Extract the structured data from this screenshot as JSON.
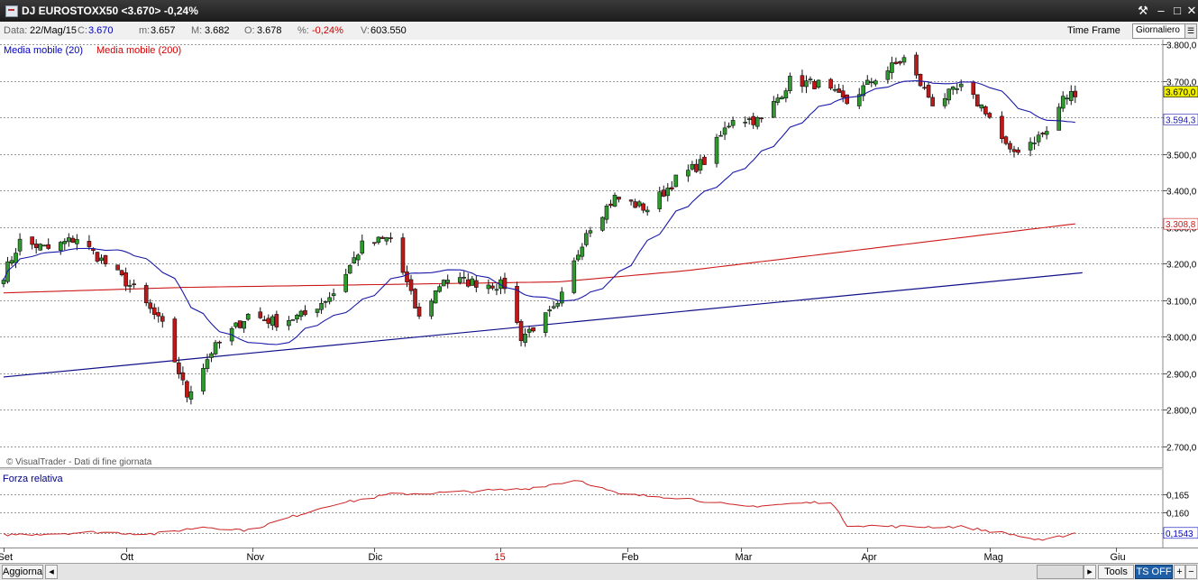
{
  "window": {
    "title": "DJ EUROSTOXX50 <3.670> -0,24%"
  },
  "infobar": {
    "data_label": "Data:",
    "data_value": "22/Mag/15",
    "c_label": "C:",
    "c_value": "3.670",
    "m_label": "m:",
    "m_value": "3.657",
    "M_label": "M:",
    "M_value": "3.682",
    "o_label": "O:",
    "o_value": "3.678",
    "pct_label": "%:",
    "pct_value": "-0,24%",
    "v_label": "V:",
    "v_value": "603.550",
    "time_frame_label": "Time Frame",
    "time_frame_value": "Giornaliero"
  },
  "legend": {
    "ma20": "Media mobile (20)",
    "ma200": "Media mobile (200)",
    "relative_strength": "Forza relativa",
    "credit": "© VisualTrader - Dati di fine giornata"
  },
  "bottombar": {
    "aggiorna": "Aggiorna",
    "tools": "Tools",
    "ts_off": "TS OFF",
    "plus": "+",
    "minus": "−"
  },
  "colors": {
    "up_candle": "#2e9a2e",
    "down_candle": "#c01818",
    "ma20": "#1a1aa8",
    "ma200": "#cc1a1a",
    "trendline": "#10108a",
    "rs_line": "#cc2020",
    "price_highlight": "#f0f000"
  },
  "chart_data": [
    {
      "type": "candlestick",
      "title": "DJ EUROSTOXX50",
      "x_axis_labels": [
        "Set",
        "Ott",
        "Nov",
        "Dic",
        "15",
        "Feb",
        "Mar",
        "Apr",
        "Mag",
        "Giu"
      ],
      "y_axis_labels": [
        "3.800,0",
        "3.700,0",
        "3.600,0",
        "3.500,0",
        "3.400,0",
        "3.300,0",
        "3.200,0",
        "3.100,0",
        "3.000,0",
        "2.900,0",
        "2.800,0",
        "2.700,0"
      ],
      "ylim": [
        2700,
        3800
      ],
      "grid": true,
      "last_price_label": "3.670,0",
      "ma20_last_label": "3.594,3",
      "ma200_last_label": "3.308,8",
      "anchors": [
        [
          "2014-09-01",
          3170
        ],
        [
          "2014-09-05",
          3260
        ],
        [
          "2014-09-12",
          3240
        ],
        [
          "2014-09-19",
          3270
        ],
        [
          "2014-09-26",
          3200
        ],
        [
          "2014-10-03",
          3130
        ],
        [
          "2014-10-10",
          3030
        ],
        [
          "2014-10-16",
          2840
        ],
        [
          "2014-10-22",
          2960
        ],
        [
          "2014-10-31",
          3060
        ],
        [
          "2014-11-07",
          3040
        ],
        [
          "2014-11-14",
          3060
        ],
        [
          "2014-11-21",
          3120
        ],
        [
          "2014-11-28",
          3250
        ],
        [
          "2014-12-05",
          3270
        ],
        [
          "2014-12-12",
          3050
        ],
        [
          "2014-12-18",
          3160
        ],
        [
          "2014-12-24",
          3150
        ],
        [
          "2015-01-02",
          3140
        ],
        [
          "2015-01-06",
          3000
        ],
        [
          "2015-01-15",
          3080
        ],
        [
          "2015-01-22",
          3290
        ],
        [
          "2015-01-29",
          3380
        ],
        [
          "2015-02-06",
          3350
        ],
        [
          "2015-02-13",
          3430
        ],
        [
          "2015-02-20",
          3480
        ],
        [
          "2015-02-27",
          3600
        ],
        [
          "2015-03-06",
          3590
        ],
        [
          "2015-03-13",
          3700
        ],
        [
          "2015-03-20",
          3690
        ],
        [
          "2015-03-27",
          3640
        ],
        [
          "2015-04-02",
          3700
        ],
        [
          "2015-04-10",
          3760
        ],
        [
          "2015-04-17",
          3640
        ],
        [
          "2015-04-24",
          3680
        ],
        [
          "2015-04-30",
          3620
        ],
        [
          "2015-05-06",
          3500
        ],
        [
          "2015-05-12",
          3540
        ],
        [
          "2015-05-15",
          3560
        ],
        [
          "2015-05-19",
          3650
        ],
        [
          "2015-05-22",
          3670
        ]
      ],
      "ma200": [
        [
          "2014-09-01",
          3120
        ],
        [
          "2014-10-15",
          3135
        ],
        [
          "2015-01-15",
          3150
        ],
        [
          "2015-02-15",
          3180
        ],
        [
          "2015-05-22",
          3308.8
        ]
      ],
      "trendline": [
        [
          "2014-09-01",
          2890
        ],
        [
          "2015-05-22",
          3175
        ]
      ]
    },
    {
      "type": "line",
      "title": "Forza relativa",
      "y_axis_labels": [
        "0,165",
        "0,160",
        "0,1543"
      ],
      "ylim": [
        0.1505,
        0.172
      ],
      "last_value_label": "0,1543",
      "anchors": [
        [
          "2014-09-01",
          0.1538
        ],
        [
          "2014-09-10",
          0.154
        ],
        [
          "2014-09-24",
          0.1545
        ],
        [
          "2014-10-08",
          0.154
        ],
        [
          "2014-10-20",
          0.156
        ],
        [
          "2014-10-31",
          0.155
        ],
        [
          "2014-11-20",
          0.162
        ],
        [
          "2014-12-05",
          0.165
        ],
        [
          "2014-12-19",
          0.1655
        ],
        [
          "2015-01-07",
          0.1665
        ],
        [
          "2015-01-20",
          0.169
        ],
        [
          "2015-01-30",
          0.165
        ],
        [
          "2015-02-15",
          0.164
        ],
        [
          "2015-03-01",
          0.1615
        ],
        [
          "2015-03-15",
          0.1625
        ],
        [
          "2015-03-23",
          0.163
        ],
        [
          "2015-03-27",
          0.1565
        ],
        [
          "2015-04-10",
          0.156
        ],
        [
          "2015-04-24",
          0.156
        ],
        [
          "2015-05-06",
          0.154
        ],
        [
          "2015-05-14",
          0.152
        ],
        [
          "2015-05-19",
          0.1535
        ],
        [
          "2015-05-22",
          0.1543
        ]
      ]
    }
  ]
}
